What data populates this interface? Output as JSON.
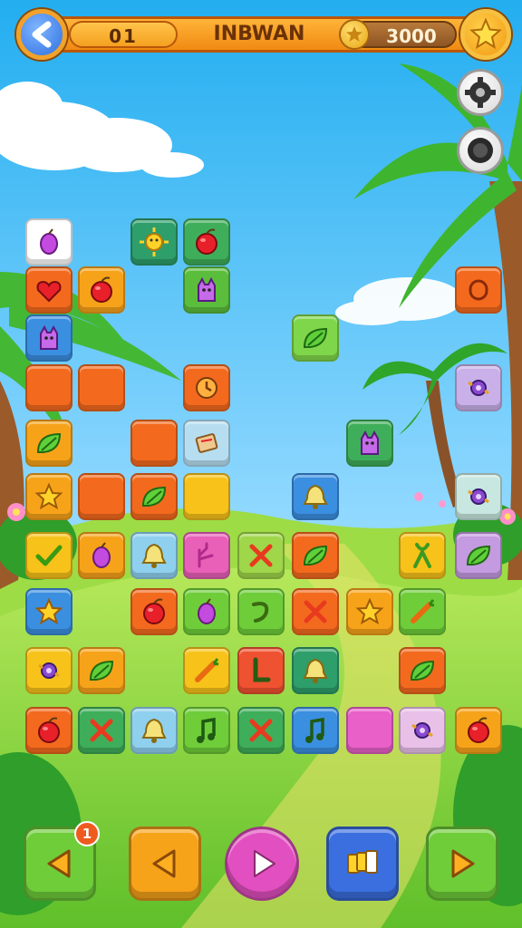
{
  "header": {
    "level": "01",
    "title": "INBWAN",
    "coins": "3000"
  },
  "controls": {
    "hint_badge_count": "1"
  },
  "colors": {
    "sky_top": "#2fb5ef",
    "sky_bottom": "#bde8ff",
    "grass": "#8fd63a",
    "header_orange": "#f49a1c"
  },
  "tiles": [
    {
      "row": 0,
      "col": 0,
      "color": "#ffffff",
      "icon": "grape"
    },
    {
      "row": 0,
      "col": 2,
      "color": "#2e9e6b",
      "icon": "sun"
    },
    {
      "row": 0,
      "col": 3,
      "color": "#3fae5a",
      "icon": "apple"
    },
    {
      "row": 1,
      "col": 0,
      "color": "#f36a1e",
      "icon": "heart"
    },
    {
      "row": 1,
      "col": 1,
      "color": "#f7a31a",
      "icon": "apple"
    },
    {
      "row": 1,
      "col": 3,
      "color": "#5bbd3c",
      "icon": "creature"
    },
    {
      "row": 1,
      "col": 8,
      "color": "#f36a1e",
      "icon": "ring"
    },
    {
      "row": 2,
      "col": 0,
      "color": "#3b8fe0",
      "icon": "creature"
    },
    {
      "row": 2,
      "col": 5,
      "color": "#7fd64a",
      "icon": "leaf"
    },
    {
      "row": 3,
      "col": 0,
      "color": "#f36a1e",
      "icon": "blank"
    },
    {
      "row": 3,
      "col": 1,
      "color": "#f36a1e",
      "icon": "blank"
    },
    {
      "row": 3,
      "col": 3,
      "color": "#f36a1e",
      "icon": "clock"
    },
    {
      "row": 3,
      "col": 8,
      "color": "#c9b0e8",
      "icon": "candy"
    },
    {
      "row": 4,
      "col": 0,
      "color": "#f7a31a",
      "icon": "leaf"
    },
    {
      "row": 4,
      "col": 2,
      "color": "#f36a1e",
      "icon": "blank"
    },
    {
      "row": 4,
      "col": 3,
      "color": "#b6def0",
      "icon": "scroll"
    },
    {
      "row": 4,
      "col": 6,
      "color": "#3fae5a",
      "icon": "creature"
    },
    {
      "row": 5,
      "col": 0,
      "color": "#f7a31a",
      "icon": "star"
    },
    {
      "row": 5,
      "col": 1,
      "color": "#f36a1e",
      "icon": "blank"
    },
    {
      "row": 5,
      "col": 2,
      "color": "#f36a1e",
      "icon": "leaf"
    },
    {
      "row": 5,
      "col": 3,
      "color": "#f8c21a",
      "icon": "blank"
    },
    {
      "row": 5,
      "col": 5,
      "color": "#3b8fe0",
      "icon": "bell"
    },
    {
      "row": 5,
      "col": 8,
      "color": "#c7e7e0",
      "icon": "candy"
    },
    {
      "row": 6,
      "col": 0,
      "color": "#f7c21a",
      "icon": "check"
    },
    {
      "row": 6,
      "col": 1,
      "color": "#f7a31a",
      "icon": "grape"
    },
    {
      "row": 6,
      "col": 2,
      "color": "#8fd0ef",
      "icon": "bell"
    },
    {
      "row": 6,
      "col": 3,
      "color": "#e860b8",
      "icon": "coral"
    },
    {
      "row": 6,
      "col": 4,
      "color": "#9fd64a",
      "icon": "cross"
    },
    {
      "row": 6,
      "col": 5,
      "color": "#f36a1e",
      "icon": "leaf"
    },
    {
      "row": 6,
      "col": 7,
      "color": "#f7c21a",
      "icon": "ribbon"
    },
    {
      "row": 6,
      "col": 8,
      "color": "#c49ae0",
      "icon": "leaf"
    },
    {
      "row": 7,
      "col": 0,
      "color": "#3b8fe0",
      "icon": "star"
    },
    {
      "row": 7,
      "col": 2,
      "color": "#f36a1e",
      "icon": "apple"
    },
    {
      "row": 7,
      "col": 3,
      "color": "#6fcd3a",
      "icon": "grape"
    },
    {
      "row": 7,
      "col": 4,
      "color": "#6fcd3a",
      "icon": "hook"
    },
    {
      "row": 7,
      "col": 5,
      "color": "#f36a1e",
      "icon": "cross"
    },
    {
      "row": 7,
      "col": 6,
      "color": "#f7a31a",
      "icon": "star"
    },
    {
      "row": 7,
      "col": 7,
      "color": "#6fcd3a",
      "icon": "carrot"
    },
    {
      "row": 8,
      "col": 0,
      "color": "#f7c21a",
      "icon": "candy"
    },
    {
      "row": 8,
      "col": 1,
      "color": "#f7a31a",
      "icon": "leaf"
    },
    {
      "row": 8,
      "col": 3,
      "color": "#f7c21a",
      "icon": "carrot"
    },
    {
      "row": 8,
      "col": 4,
      "color": "#ef5230",
      "icon": "letterL"
    },
    {
      "row": 8,
      "col": 5,
      "color": "#2e9e6b",
      "icon": "bell"
    },
    {
      "row": 8,
      "col": 7,
      "color": "#f36a1e",
      "icon": "leaf"
    },
    {
      "row": 9,
      "col": 0,
      "color": "#f36a1e",
      "icon": "apple"
    },
    {
      "row": 9,
      "col": 1,
      "color": "#3fae5a",
      "icon": "cross"
    },
    {
      "row": 9,
      "col": 2,
      "color": "#8fd0ef",
      "icon": "bell"
    },
    {
      "row": 9,
      "col": 3,
      "color": "#6fcd3a",
      "icon": "note"
    },
    {
      "row": 9,
      "col": 4,
      "color": "#3fae5a",
      "icon": "cross"
    },
    {
      "row": 9,
      "col": 5,
      "color": "#3b8fe0",
      "icon": "note"
    },
    {
      "row": 9,
      "col": 6,
      "color": "#e860c8",
      "icon": "blank"
    },
    {
      "row": 9,
      "col": 7,
      "color": "#e8c0e8",
      "icon": "candy"
    },
    {
      "row": 9,
      "col": 8,
      "color": "#f7a31a",
      "icon": "apple"
    }
  ],
  "nav_buttons": [
    {
      "name": "hint-button",
      "color": "#6fcd3a",
      "icon": "arrow-left-icon"
    },
    {
      "name": "undo-button",
      "color": "#f7a31a",
      "icon": "arrow-left-icon"
    },
    {
      "name": "play-button",
      "color": "#e24fc0",
      "icon": "play-icon"
    },
    {
      "name": "shuffle-button",
      "color": "#3b6fe0",
      "icon": "shuffle-icon"
    },
    {
      "name": "next-button",
      "color": "#6fcd3a",
      "icon": "arrow-right-icon"
    }
  ]
}
